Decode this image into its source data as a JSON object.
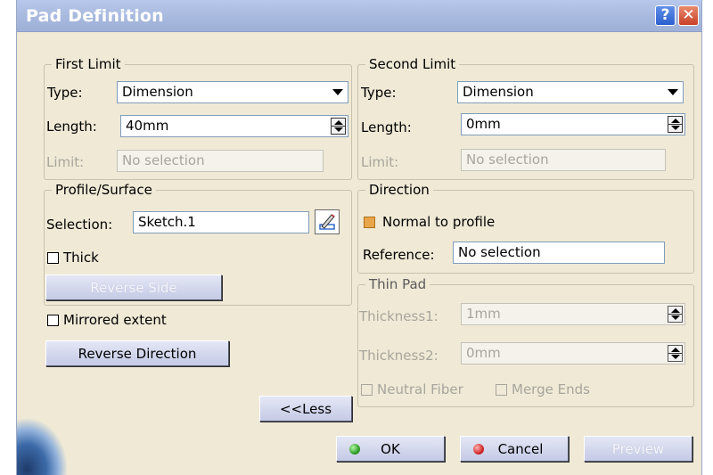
{
  "window": {
    "title": "Pad Definition",
    "help_glyph": "?",
    "close_glyph": "✕"
  },
  "first_limit": {
    "legend": "First Limit",
    "type_label": "Type:",
    "type_value": "Dimension",
    "length_label": "Length:",
    "length_value": "40mm",
    "limit_label": "Limit:",
    "limit_value": "No selection"
  },
  "second_limit": {
    "legend": "Second Limit",
    "type_label": "Type:",
    "type_value": "Dimension",
    "length_label": "Length:",
    "length_value": "0mm",
    "limit_label": "Limit:",
    "limit_value": "No selection"
  },
  "profile_surface": {
    "legend": "Profile/Surface",
    "selection_label": "Selection:",
    "selection_value": "Sketch.1",
    "thick_label": "Thick",
    "thick_checked": false,
    "reverse_side_label": "Reverse Side"
  },
  "direction": {
    "legend": "Direction",
    "normal_label": "Normal to profile",
    "normal_checked": true,
    "reference_label": "Reference:",
    "reference_value": "No selection"
  },
  "thin_pad": {
    "legend": "Thin Pad",
    "thickness1_label": "Thickness1:",
    "thickness1_value": "1mm",
    "thickness2_label": "Thickness2:",
    "thickness2_value": "0mm",
    "neutral_fiber_label": "Neutral Fiber",
    "merge_ends_label": "Merge Ends"
  },
  "options": {
    "mirrored_label": "Mirrored extent",
    "mirrored_checked": false,
    "reverse_direction_label": "Reverse Direction",
    "less_label": "<<Less"
  },
  "footer": {
    "ok_label": "OK",
    "cancel_label": "Cancel",
    "preview_label": "Preview"
  },
  "colors": {
    "dialog_bg": "#efe9d6",
    "titlebar": "#a9badf",
    "ok_indicator": "#2ea02a",
    "cancel_indicator": "#d42a2a",
    "checked_box": "#e8a54a"
  },
  "icons": {
    "sketcher": "sketcher-icon",
    "help": "help-icon",
    "close": "close-icon"
  }
}
